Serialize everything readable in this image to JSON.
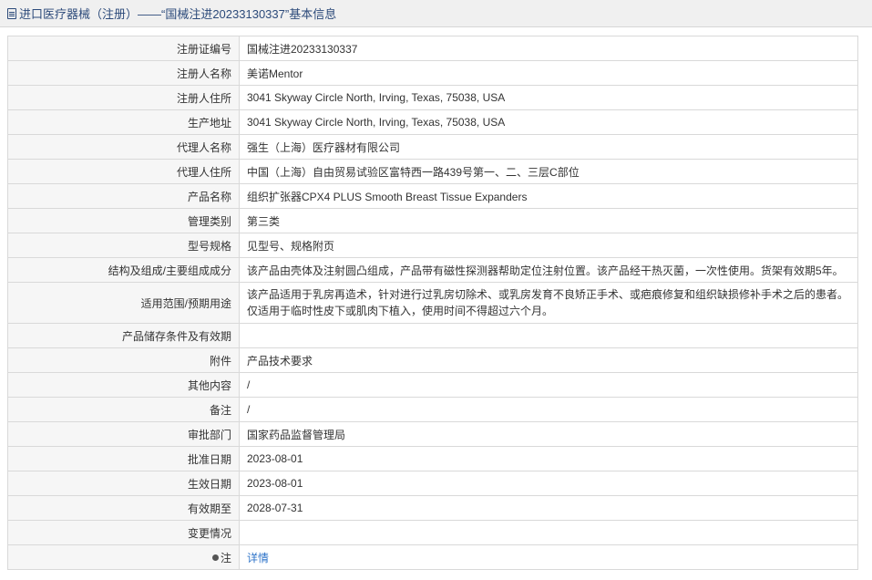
{
  "header": {
    "prefix": "进口医疗器械（注册）——“国械注进20233130337”基本信息"
  },
  "rows": [
    {
      "label": "注册证编号",
      "value": "国械注进20233130337"
    },
    {
      "label": "注册人名称",
      "value": "美诺Mentor"
    },
    {
      "label": "注册人住所",
      "value": "3041 Skyway Circle North, Irving, Texas, 75038, USA"
    },
    {
      "label": "生产地址",
      "value": "3041 Skyway Circle North, Irving, Texas, 75038, USA"
    },
    {
      "label": "代理人名称",
      "value": "强生（上海）医疗器材有限公司"
    },
    {
      "label": "代理人住所",
      "value": "中国（上海）自由贸易试验区富特西一路439号第一、二、三层C部位"
    },
    {
      "label": "产品名称",
      "value": "组织扩张器CPX4 PLUS Smooth Breast Tissue Expanders"
    },
    {
      "label": "管理类别",
      "value": "第三类"
    },
    {
      "label": "型号规格",
      "value": "见型号、规格附页"
    },
    {
      "label": "结构及组成/主要组成成分",
      "value": "该产品由壳体及注射圆凸组成，产品带有磁性探测器帮助定位注射位置。该产品经干热灭菌，一次性使用。货架有效期5年。"
    },
    {
      "label": "适用范围/预期用途",
      "value": "该产品适用于乳房再造术，针对进行过乳房切除术、或乳房发育不良矫正手术、或疤痕修复和组织缺损修补手术之后的患者。仅适用于临时性皮下或肌肉下植入，使用时间不得超过六个月。"
    },
    {
      "label": "产品储存条件及有效期",
      "value": ""
    },
    {
      "label": "附件",
      "value": "产品技术要求"
    },
    {
      "label": "其他内容",
      "value": "/"
    },
    {
      "label": "备注",
      "value": "/"
    },
    {
      "label": "审批部门",
      "value": "国家药品监督管理局"
    },
    {
      "label": "批准日期",
      "value": "2023-08-01"
    },
    {
      "label": "生效日期",
      "value": "2023-08-01"
    },
    {
      "label": "有效期至",
      "value": "2028-07-31"
    },
    {
      "label": "变更情况",
      "value": ""
    }
  ],
  "note": {
    "label": "注",
    "link": "详情"
  }
}
